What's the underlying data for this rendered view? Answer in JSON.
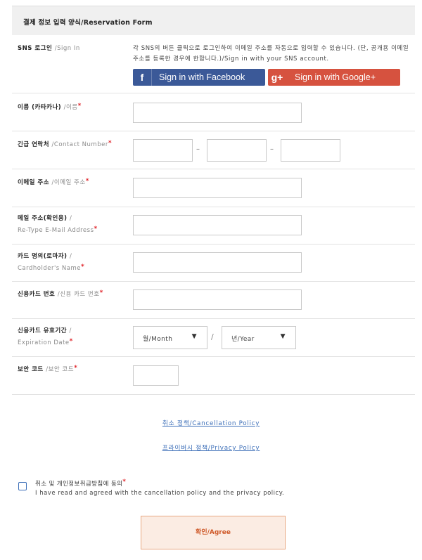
{
  "header": {
    "title": "결제 정보 입력 양식/Reservation Form"
  },
  "sns": {
    "label": "SNS 로그인",
    "label_en": "/Sign In",
    "description": "각 SNS의 버튼 클릭으로 로그인하여 이메일 주소를 자동으로 입력할 수 있습니다. (단, 공개용 이메일 주소를 등록한 경우에 한합니다.)/Sign in with your SNS account.",
    "facebook_icon": "f",
    "facebook_label": "Sign in with Facebook",
    "google_icon": "g+",
    "google_label": "Sign in with Google+",
    "colors": {
      "facebook": "#3b5998",
      "google": "#d6523f"
    }
  },
  "fields": {
    "name": {
      "label": "이름 (카타카나)",
      "label_en": "/이름",
      "required": "*"
    },
    "contact": {
      "label": "긴급 연락처",
      "label_en": "/Contact Number",
      "required": "*",
      "separator": "–"
    },
    "email": {
      "label": "이메일 주소",
      "label_en": "/이메일 주소",
      "required": "*"
    },
    "email_confirm": {
      "label": "메일 주소(확인용)",
      "label_en": "/",
      "label_line2": "Re-Type E-Mail Address",
      "required": "*"
    },
    "card_name": {
      "label": "카드 명의(로마자)",
      "label_en": "/",
      "label_line2": "Cardholder's Name",
      "required": "*"
    },
    "card_number": {
      "label": "신용카드 번호",
      "label_en": "/신용 카드 번호",
      "required": "*"
    },
    "expiration": {
      "label": "신용카드 유효기간",
      "label_en": "/",
      "label_line2": "Expiration Date",
      "required": "*",
      "month_value": "월/Month",
      "year_value": "년/Year",
      "separator": "/"
    },
    "security": {
      "label": "보안 코드",
      "label_en": "/보안 코드",
      "required": "*"
    }
  },
  "links": {
    "cancellation": "취소 정책/Cancellation Policy",
    "privacy": "프라이버시 정책/Privacy Policy"
  },
  "agreement": {
    "label_ko": "취소 및 개인정보취급방침에 동의",
    "required": "*",
    "label_en": "I have read and agreed with the cancellation policy and the privacy policy.",
    "button_label": "확인/Agree"
  }
}
